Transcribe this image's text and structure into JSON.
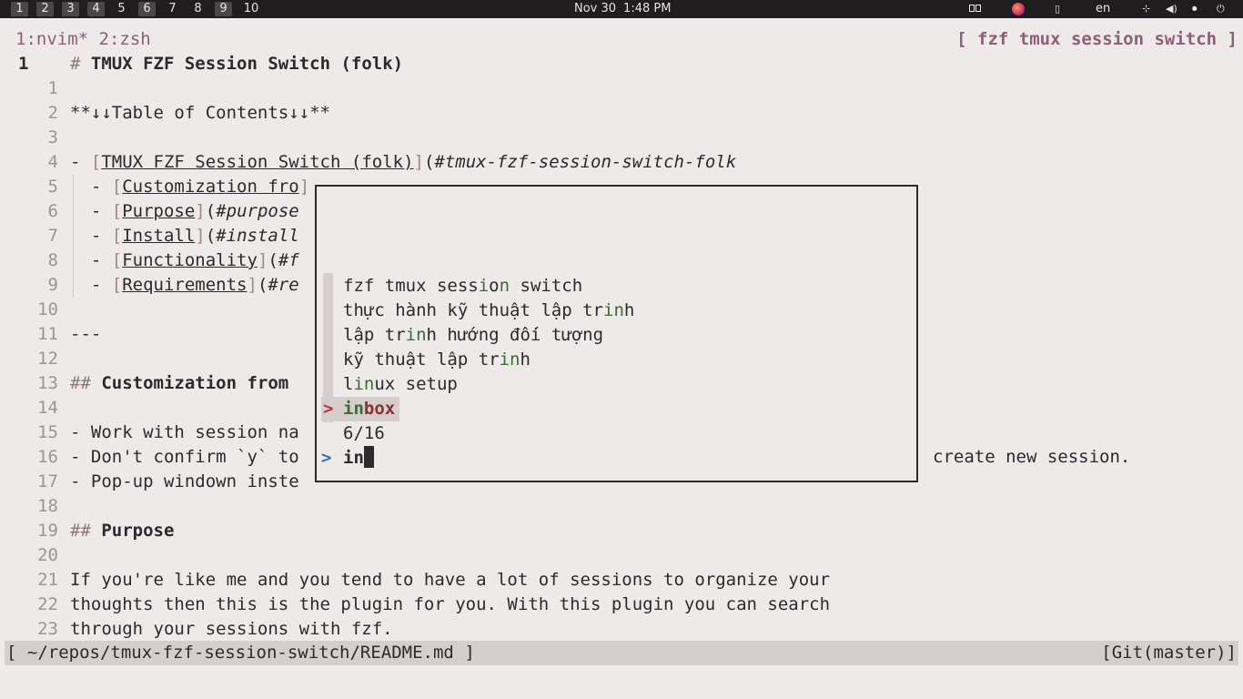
{
  "topbar": {
    "workspaces": [
      {
        "label": "1",
        "occupied": true
      },
      {
        "label": "2",
        "occupied": true
      },
      {
        "label": "3",
        "occupied": true
      },
      {
        "label": "4",
        "occupied": true
      },
      {
        "label": "5",
        "occupied": false
      },
      {
        "label": "6",
        "occupied": true
      },
      {
        "label": "7",
        "occupied": false
      },
      {
        "label": "8",
        "occupied": false
      },
      {
        "label": "9",
        "occupied": true
      },
      {
        "label": "10",
        "occupied": false
      }
    ],
    "date": "Nov 30",
    "time": "1:48 PM",
    "language": "en"
  },
  "tmux": {
    "windows": "1:nvim* 2:zsh",
    "session_label": "[ fzf tmux session switch ]"
  },
  "editor": {
    "current_line_number": "1",
    "heading_marker": "#",
    "title": "TMUX FZF Session Switch (folk)",
    "lines": [
      {
        "n": "1",
        "text": ""
      },
      {
        "n": "2",
        "text": "**↓↓Table of Contents↓↓**"
      },
      {
        "n": "3",
        "text": ""
      },
      {
        "n": "4",
        "prefix": "- ",
        "link": "TMUX FZF Session Switch (folk)",
        "url": "#tmux-fzf-session-switch-folk"
      },
      {
        "n": "5",
        "prefix": "  - ",
        "link": "Customization fro",
        "url": ""
      },
      {
        "n": "6",
        "prefix": "  - ",
        "link": "Purpose",
        "url": "#purpose"
      },
      {
        "n": "7",
        "prefix": "  - ",
        "link": "Install",
        "url": "#install"
      },
      {
        "n": "8",
        "prefix": "  - ",
        "link": "Functionality",
        "url": "#f"
      },
      {
        "n": "9",
        "prefix": "  - ",
        "link": "Requirements",
        "url": "#re"
      },
      {
        "n": "10",
        "text": ""
      },
      {
        "n": "11",
        "text": "---"
      },
      {
        "n": "12",
        "text": ""
      },
      {
        "n": "13",
        "hashes": "##",
        "heading": "Customization from"
      },
      {
        "n": "14",
        "text": ""
      },
      {
        "n": "15",
        "text": "- Work with session na"
      },
      {
        "n": "16",
        "text": "- Don't confirm `y` to",
        "tail": "create new session."
      },
      {
        "n": "17",
        "text": "- Pop-up windown inste"
      },
      {
        "n": "18",
        "text": ""
      },
      {
        "n": "19",
        "hashes": "##",
        "heading": "Purpose"
      },
      {
        "n": "20",
        "text": ""
      },
      {
        "n": "21",
        "text": "If you're like me and you tend to have a lot of sessions to organize your"
      },
      {
        "n": "22",
        "text": "thoughts then this is the plugin for you. With this plugin you can search"
      },
      {
        "n": "23",
        "text": "through your sessions with fzf."
      }
    ]
  },
  "statusline": {
    "file": "[ ~/repos/tmux-fzf-session-switch/README.md ]",
    "git": "[Git(master)]"
  },
  "fzf": {
    "items": [
      {
        "pre": "fzf tmux sess",
        "m1": "i",
        "mid": "o",
        "m2": "n",
        "post": " switch"
      },
      {
        "pre": "thực hành kỹ thuật lập tr",
        "m1": "i",
        "mid": "",
        "m2": "n",
        "post": "h"
      },
      {
        "pre": "lập tr",
        "m1": "i",
        "mid": "",
        "m2": "n",
        "post": "h hướng đối tượng"
      },
      {
        "pre": "kỹ thuật lập tr",
        "m1": "i",
        "mid": "",
        "m2": "n",
        "post": "h"
      },
      {
        "pre": "l",
        "m1": "i",
        "mid": "",
        "m2": "n",
        "post": "ux setup"
      }
    ],
    "selected_pointer": ">",
    "selected": {
      "match": "in",
      "rest": "box"
    },
    "count": "6/16",
    "prompt": ">",
    "query": "in"
  }
}
